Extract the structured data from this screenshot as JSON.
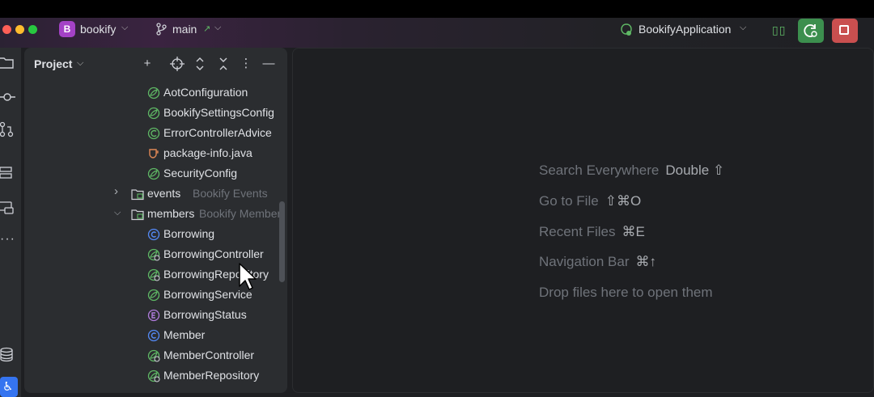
{
  "titlebar": {
    "project_initial": "B",
    "project_name": "bookify",
    "branch": "main",
    "run_config": "BookifyApplication"
  },
  "project_panel": {
    "title": "Project",
    "tree": [
      {
        "name": "AotConfiguration",
        "icon": "spring-config-icon",
        "hint": ""
      },
      {
        "name": "BookifySettingsConfig",
        "icon": "spring-config-icon",
        "hint": ""
      },
      {
        "name": "ErrorControllerAdvice",
        "icon": "spring-class-icon",
        "hint": ""
      },
      {
        "name": "package-info.java",
        "icon": "package-info-icon",
        "hint": ""
      },
      {
        "name": "SecurityConfig",
        "icon": "spring-config-icon",
        "hint": ""
      },
      {
        "name": "events",
        "icon": "module-package-icon",
        "hint": "Bookify Events",
        "expanded": false
      },
      {
        "name": "members",
        "icon": "module-package-icon",
        "hint": "Bookify Member",
        "expanded": true
      },
      {
        "name": "Borrowing",
        "icon": "class-icon",
        "hint": ""
      },
      {
        "name": "BorrowingController",
        "icon": "spring-controller-icon",
        "hint": ""
      },
      {
        "name": "BorrowingRepository",
        "icon": "spring-repository-icon",
        "hint": ""
      },
      {
        "name": "BorrowingService",
        "icon": "spring-config-icon",
        "hint": ""
      },
      {
        "name": "BorrowingStatus",
        "icon": "enum-icon",
        "hint": ""
      },
      {
        "name": "Member",
        "icon": "class-icon",
        "hint": ""
      },
      {
        "name": "MemberController",
        "icon": "spring-controller-icon",
        "hint": ""
      },
      {
        "name": "MemberRepository",
        "icon": "spring-repository-icon",
        "hint": ""
      }
    ]
  },
  "editor_hints": [
    {
      "label": "Search Everywhere",
      "key": "Double ⇧"
    },
    {
      "label": "Go to File",
      "key": "⇧⌘O"
    },
    {
      "label": "Recent Files",
      "key": "⌘E"
    },
    {
      "label": "Navigation Bar",
      "key": "⌘↑"
    },
    {
      "label": "Drop files here to open them",
      "key": ""
    }
  ],
  "colors": {
    "accent_project": "#a442c6",
    "run_button": "#3c8f4e",
    "stop_button": "#c94f4f",
    "spring_green": "#5fb865",
    "class_blue": "#548af7",
    "enum_purple": "#b07cdd"
  }
}
